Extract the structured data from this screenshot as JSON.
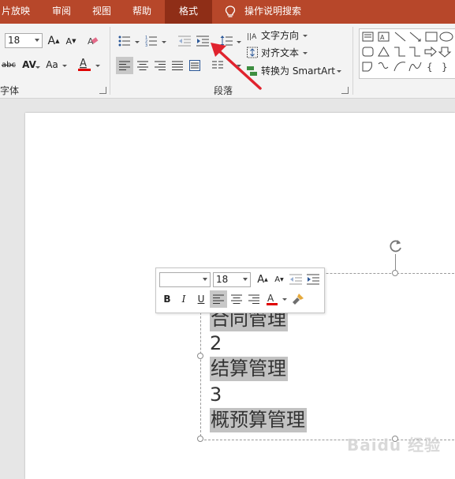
{
  "tabs": [
    {
      "label": "片放映",
      "active": false
    },
    {
      "label": "审阅",
      "active": false
    },
    {
      "label": "视图",
      "active": false
    },
    {
      "label": "帮助",
      "active": false
    },
    {
      "label": "格式",
      "active": true
    }
  ],
  "tell_me": {
    "label": "操作说明搜索",
    "icon": "lightbulb-icon"
  },
  "ribbon": {
    "font_group": {
      "label": "字体",
      "font_size": "18",
      "spacing_label": "abc",
      "case_label": "Aa"
    },
    "paragraph_group": {
      "label": "段落",
      "text_direction": "文字方向",
      "align_text": "对齐文本",
      "convert_smartart": "转换为 SmartArt"
    }
  },
  "slide": {
    "lines": [
      {
        "text": "合同管理",
        "highlighted": true
      },
      {
        "text": "2",
        "highlighted": false
      },
      {
        "text": "结算管理",
        "highlighted": true
      },
      {
        "text": "3",
        "highlighted": false
      },
      {
        "text": "概预算管理",
        "highlighted": true
      }
    ]
  },
  "mini_toolbar": {
    "font_name": "",
    "font_size": "18",
    "bold": "B",
    "italic": "I",
    "underline": "U"
  },
  "watermark": "Baidu 经验",
  "colors": {
    "tab_bar": "#b7472a",
    "tab_active": "#8f2e17",
    "ribbon_bg": "#f3f3f3",
    "font_color_bar": "#e00000",
    "highlight": "#c2c2c2",
    "indent_icon": "#2b5797",
    "arrow": "#e0232e"
  }
}
